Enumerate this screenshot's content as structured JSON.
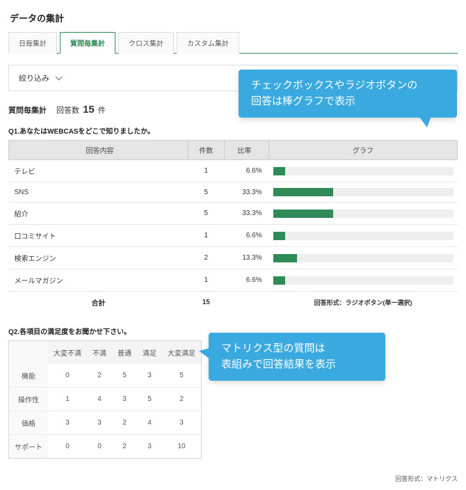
{
  "page_title": "データの集計",
  "tabs": [
    {
      "label": "日毎集計",
      "active": false
    },
    {
      "label": "質問毎集計",
      "active": true
    },
    {
      "label": "クロス集計",
      "active": false
    },
    {
      "label": "カスタム集計",
      "active": false
    }
  ],
  "filter_label": "絞り込み",
  "summary": {
    "label": "質問毎集計",
    "count_label_prefix": "回答数",
    "count_value": "15",
    "count_label_suffix": "件"
  },
  "q1": {
    "title": "Q1.あなたはWEBCASをどこで知りましたか。",
    "headers": {
      "answer": "回答内容",
      "count": "件数",
      "ratio": "比率",
      "graph": "グラフ"
    },
    "rows": [
      {
        "label": "テレビ",
        "count": 1,
        "ratio": "6.6%",
        "pct": 6.6
      },
      {
        "label": "SNS",
        "count": 5,
        "ratio": "33.3%",
        "pct": 33.3
      },
      {
        "label": "紹介",
        "count": 5,
        "ratio": "33.3%",
        "pct": 33.3
      },
      {
        "label": "口コミサイト",
        "count": 1,
        "ratio": "6.6%",
        "pct": 6.6
      },
      {
        "label": "検索エンジン",
        "count": 2,
        "ratio": "13.3%",
        "pct": 13.3
      },
      {
        "label": "メールマガジン",
        "count": 1,
        "ratio": "6.6%",
        "pct": 6.6
      }
    ],
    "total_label": "合計",
    "total_count": "15",
    "answer_type": "回答形式：ラジオボタン(単一選択)"
  },
  "q2": {
    "title": "Q2.各項目の満足度をお聞かせ下さい。",
    "col_headers": [
      "大変不満",
      "不満",
      "普通",
      "満足",
      "大変満足"
    ],
    "rows": [
      {
        "label": "機能",
        "values": [
          0,
          2,
          5,
          3,
          5
        ]
      },
      {
        "label": "操作性",
        "values": [
          1,
          4,
          3,
          5,
          2
        ]
      },
      {
        "label": "価格",
        "values": [
          3,
          3,
          2,
          4,
          3
        ]
      },
      {
        "label": "サポート",
        "values": [
          0,
          0,
          2,
          3,
          10
        ]
      }
    ],
    "answer_type": "回答形式：マトリクス"
  },
  "callouts": {
    "c1_line1": "チェックボックスやラジオボタンの",
    "c1_line2": "回答は棒グラフで表示",
    "c2_line1": "マトリクス型の質問は",
    "c2_line2": "表組みで回答結果を表示"
  },
  "chart_data": {
    "type": "bar",
    "categories": [
      "テレビ",
      "SNS",
      "紹介",
      "口コミサイト",
      "検索エンジン",
      "メールマガジン"
    ],
    "values": [
      1,
      5,
      5,
      1,
      2,
      1
    ],
    "percentages": [
      6.6,
      33.3,
      33.3,
      6.6,
      13.3,
      6.6
    ],
    "title": "Q1.あなたはWEBCASをどこで知りましたか。",
    "xlabel": "比率",
    "ylabel": "回答内容",
    "ylim": [
      0,
      100
    ]
  }
}
